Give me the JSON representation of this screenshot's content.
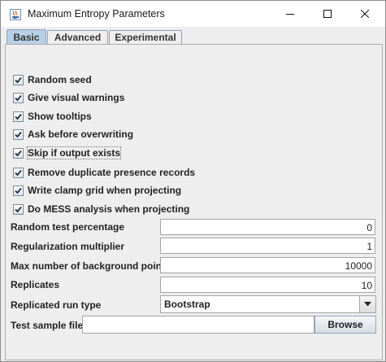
{
  "window": {
    "title": "Maximum Entropy Parameters"
  },
  "tabs": [
    {
      "label": "Basic",
      "active": true
    },
    {
      "label": "Advanced",
      "active": false
    },
    {
      "label": "Experimental",
      "active": false
    }
  ],
  "checkboxes": [
    {
      "label": "Random seed",
      "checked": true
    },
    {
      "label": "Give visual warnings",
      "checked": true
    },
    {
      "label": "Show tooltips",
      "checked": true
    },
    {
      "label": "Ask before overwriting",
      "checked": true
    },
    {
      "label": "Skip if output exists",
      "checked": true,
      "focused": true
    },
    {
      "label": "Remove duplicate presence records",
      "checked": true
    },
    {
      "label": "Write clamp grid when projecting",
      "checked": true
    },
    {
      "label": "Do MESS analysis when projecting",
      "checked": true
    }
  ],
  "fields": [
    {
      "label": "Random test percentage",
      "value": "0"
    },
    {
      "label": "Regularization multiplier",
      "value": "1"
    },
    {
      "label": "Max number of background points",
      "value": "10000"
    },
    {
      "label": "Replicates",
      "value": "10"
    }
  ],
  "replicated_run_type": {
    "label": "Replicated run type",
    "value": "Bootstrap"
  },
  "test_sample_file": {
    "label": "Test sample file",
    "value": "",
    "browse_label": "Browse"
  },
  "colors": {
    "active_tab": "#b8cfe5",
    "panel_bg": "#eeeeee",
    "check_mark": "#1f2d3d"
  }
}
